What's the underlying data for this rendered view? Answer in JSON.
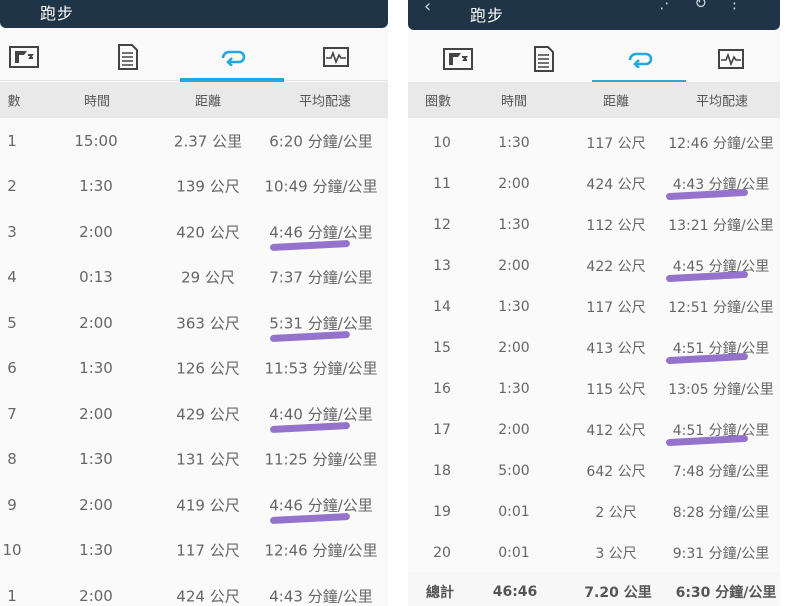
{
  "left": {
    "app_title": "跑步",
    "tabs": [
      {
        "icon": "flag-icon",
        "active": false
      },
      {
        "icon": "document-icon",
        "active": false
      },
      {
        "icon": "laps-icon",
        "active": true
      },
      {
        "icon": "chart-icon",
        "active": false
      }
    ],
    "headers": {
      "lap": "數",
      "time": "時間",
      "distance": "距離",
      "pace": "平均配速"
    },
    "rows": [
      {
        "lap": "1",
        "time": "15:00",
        "distance": "2.37 公里",
        "pace": "6:20 分鐘/公里",
        "marked": false
      },
      {
        "lap": "2",
        "time": "1:30",
        "distance": "139 公尺",
        "pace": "10:49 分鐘/公里",
        "marked": false
      },
      {
        "lap": "3",
        "time": "2:00",
        "distance": "420 公尺",
        "pace": "4:46 分鐘/公里",
        "marked": true
      },
      {
        "lap": "4",
        "time": "0:13",
        "distance": "29 公尺",
        "pace": "7:37 分鐘/公里",
        "marked": false
      },
      {
        "lap": "5",
        "time": "2:00",
        "distance": "363 公尺",
        "pace": "5:31 分鐘/公里",
        "marked": true
      },
      {
        "lap": "6",
        "time": "1:30",
        "distance": "126 公尺",
        "pace": "11:53 分鐘/公里",
        "marked": false
      },
      {
        "lap": "7",
        "time": "2:00",
        "distance": "429 公尺",
        "pace": "4:40 分鐘/公里",
        "marked": true
      },
      {
        "lap": "8",
        "time": "1:30",
        "distance": "131 公尺",
        "pace": "11:25 分鐘/公里",
        "marked": false
      },
      {
        "lap": "9",
        "time": "2:00",
        "distance": "419 公尺",
        "pace": "4:46 分鐘/公里",
        "marked": true
      },
      {
        "lap": "10",
        "time": "1:30",
        "distance": "117 公尺",
        "pace": "12:46 分鐘/公里",
        "marked": false
      },
      {
        "lap": "1",
        "time": "2:00",
        "distance": "424 公尺",
        "pace": "4:43 分鐘/公里",
        "marked": false
      }
    ]
  },
  "right": {
    "app_title": "跑步",
    "tabs": [
      {
        "icon": "flag-icon",
        "active": false
      },
      {
        "icon": "document-icon",
        "active": false
      },
      {
        "icon": "laps-icon",
        "active": true
      },
      {
        "icon": "chart-icon",
        "active": false
      }
    ],
    "headers": {
      "lap": "圈數",
      "time": "時間",
      "distance": "距離",
      "pace": "平均配速"
    },
    "rows": [
      {
        "lap": "10",
        "time": "1:30",
        "distance": "117 公尺",
        "pace": "12:46 分鐘/公里",
        "marked": false
      },
      {
        "lap": "11",
        "time": "2:00",
        "distance": "424 公尺",
        "pace": "4:43 分鐘/公里",
        "marked": true
      },
      {
        "lap": "12",
        "time": "1:30",
        "distance": "112 公尺",
        "pace": "13:21 分鐘/公里",
        "marked": false
      },
      {
        "lap": "13",
        "time": "2:00",
        "distance": "422 公尺",
        "pace": "4:45 分鐘/公里",
        "marked": true
      },
      {
        "lap": "14",
        "time": "1:30",
        "distance": "117 公尺",
        "pace": "12:51 分鐘/公里",
        "marked": false
      },
      {
        "lap": "15",
        "time": "2:00",
        "distance": "413 公尺",
        "pace": "4:51 分鐘/公里",
        "marked": true
      },
      {
        "lap": "16",
        "time": "1:30",
        "distance": "115 公尺",
        "pace": "13:05 分鐘/公里",
        "marked": false
      },
      {
        "lap": "17",
        "time": "2:00",
        "distance": "412 公尺",
        "pace": "4:51 分鐘/公里",
        "marked": true
      },
      {
        "lap": "18",
        "time": "5:00",
        "distance": "642 公尺",
        "pace": "7:48 分鐘/公里",
        "marked": false
      },
      {
        "lap": "19",
        "time": "0:01",
        "distance": "2 公尺",
        "pace": "8:28 分鐘/公里",
        "marked": false
      },
      {
        "lap": "20",
        "time": "0:01",
        "distance": "3 公尺",
        "pace": "9:31 分鐘/公里",
        "marked": false
      }
    ],
    "total": {
      "lap": "總計",
      "time": "46:46",
      "distance": "7.20 公里",
      "pace": "6:30 分鐘/公里"
    }
  },
  "colors": {
    "app_bar": "#1f3446",
    "active_tab": "#24a7e0",
    "highlight": "#8a63c7"
  }
}
